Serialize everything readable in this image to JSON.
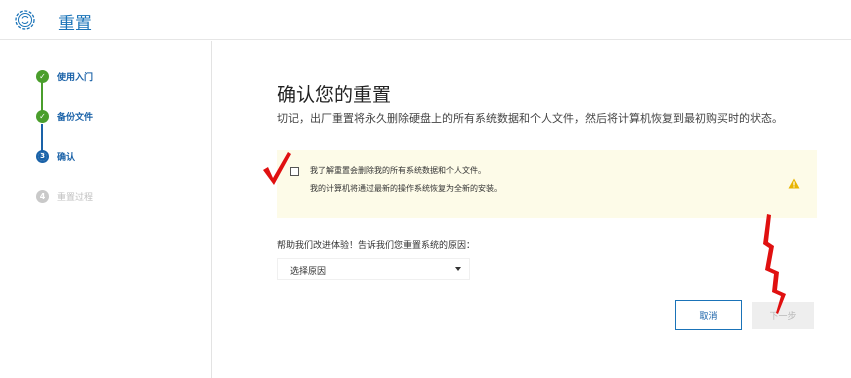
{
  "header": {
    "title": "重置",
    "icon": "gear-sync-icon"
  },
  "sidebar": {
    "steps": [
      {
        "label": "使用入门",
        "state": "done"
      },
      {
        "label": "备份文件",
        "state": "done"
      },
      {
        "label": "确认",
        "state": "current",
        "number": "3"
      },
      {
        "label": "重置过程",
        "state": "todo",
        "number": "4"
      }
    ]
  },
  "main": {
    "title": "确认您的重置",
    "subtitle": "切记，出厂重置将永久删除硬盘上的所有系统数据和个人文件，然后将计算机恢复到最初购买时的状态。",
    "warning": {
      "checkbox_label": "我了解重置会删除我的所有系统数据和个人文件。",
      "note": "我的计算机将通过最新的操作系统恢复为全新的安装。",
      "checked": false
    },
    "help_label": "帮助我们改进体验！告诉我们您重置系统的原因：",
    "reason_select": {
      "value": "选择原因"
    },
    "buttons": {
      "cancel": "取消",
      "next": "下一步"
    }
  },
  "colors": {
    "accent": "#1a73b8",
    "done": "#4a9e2c",
    "warning_bg": "#fdfbe8",
    "annotation": "#e01010"
  }
}
